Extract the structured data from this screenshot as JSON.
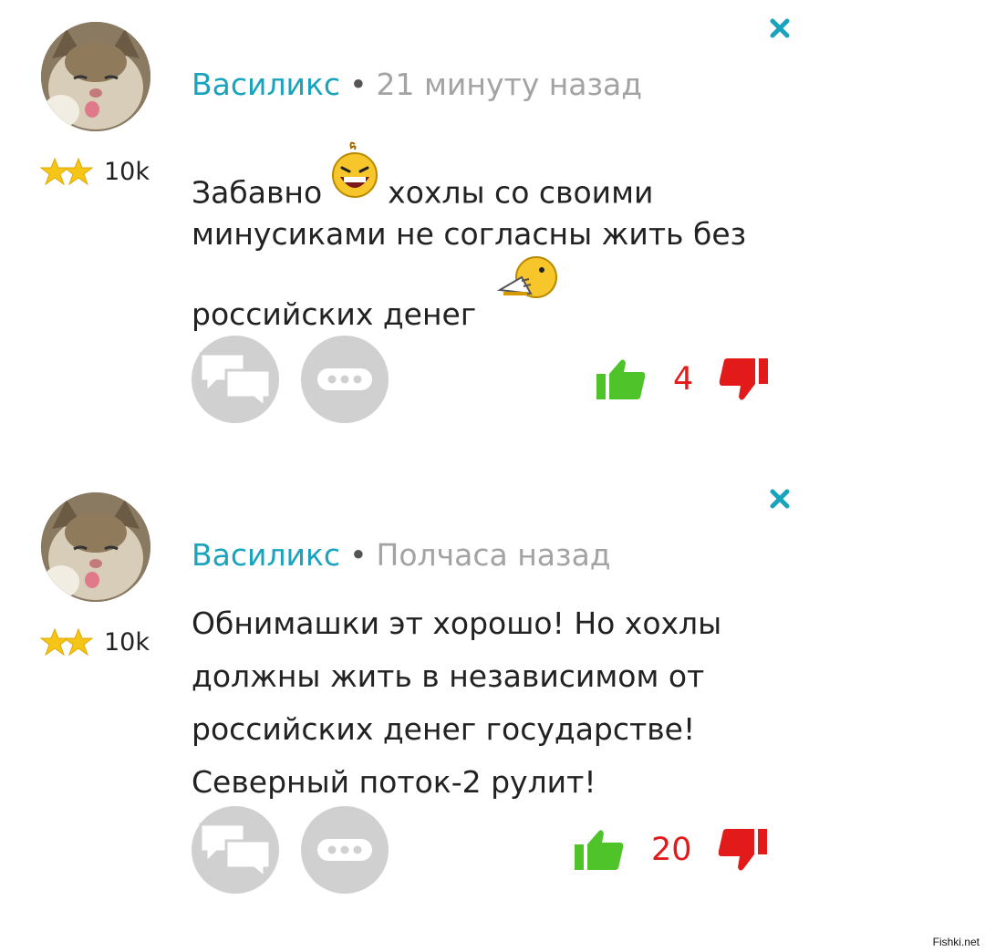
{
  "comments": [
    {
      "author": "Василикс",
      "separator": "•",
      "time": "21 минуту назад",
      "rating": "10k",
      "text_lines": [
        "Забавно",
        "хохлы со своими",
        "минусиками не согласны жить без",
        "российских денег"
      ],
      "score": "4",
      "icons": {
        "close": "close-icon",
        "reply": "speech-bubbles-icon",
        "more": "ellipsis-icon",
        "like": "thumbs-up-icon",
        "dislike": "thumbs-down-icon",
        "emoji_1": "laughing-smiley-icon",
        "emoji_2": "crying-smiley-icon"
      }
    },
    {
      "author": "Василикс",
      "separator": "•",
      "time": "Полчаса назад",
      "rating": "10k",
      "text_lines": [
        "Обнимашки эт хорошо! Но хохлы",
        "должны жить в независимом от",
        "российских денег государстве!",
        "Северный поток-2 рулит!"
      ],
      "score": "20",
      "icons": {
        "close": "close-icon",
        "reply": "speech-bubbles-icon",
        "more": "ellipsis-icon",
        "like": "thumbs-up-icon",
        "dislike": "thumbs-down-icon"
      }
    }
  ],
  "colors": {
    "author": "#1aa3bd",
    "time": "#a3a3a3",
    "score": "#e31a1a",
    "like": "#4fc32a",
    "dislike": "#e31a1a",
    "close": "#1aa3bd",
    "button_bg": "#d0d0d0"
  },
  "watermark": "Fishki.net"
}
